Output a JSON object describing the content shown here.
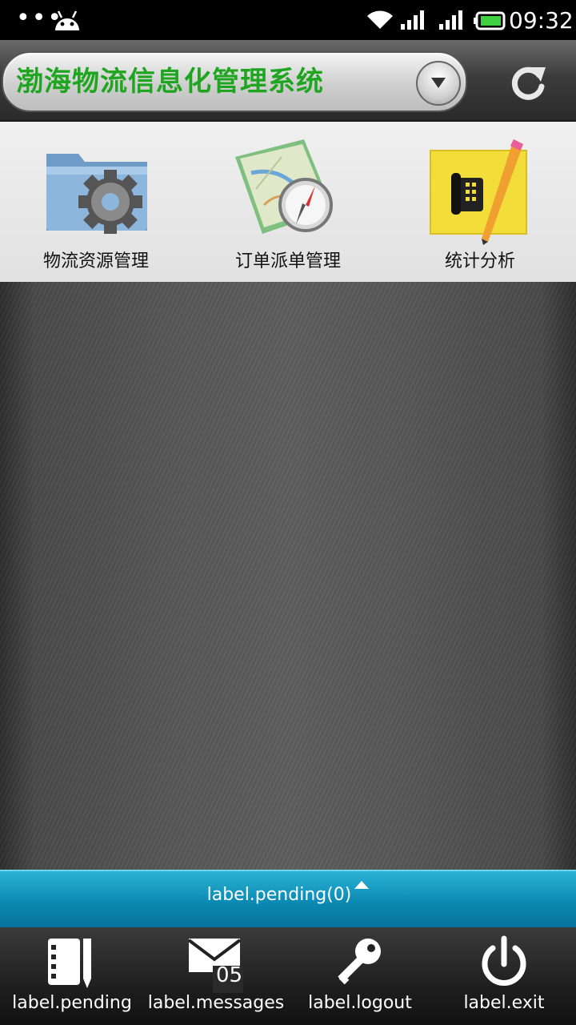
{
  "status_bar": {
    "time": "09:32",
    "icons": [
      "more-dots-icon",
      "android-icon",
      "wifi-icon",
      "signal-icon",
      "signal-icon",
      "battery-icon"
    ]
  },
  "header": {
    "title": "渤海物流信息化管理系统",
    "title_color": "#1fa51f"
  },
  "modules": [
    {
      "label": "物流资源管理",
      "icon": "folder-gear-icon"
    },
    {
      "label": "订单派单管理",
      "icon": "map-compass-icon"
    },
    {
      "label": "统计分析",
      "icon": "phone-note-icon"
    }
  ],
  "pending_bar": {
    "text": "label.pending(0)",
    "color": "#0b8ab3"
  },
  "bottom_nav": {
    "items": [
      {
        "label": "label.pending",
        "icon": "pending-list-icon"
      },
      {
        "label": "label.messages",
        "icon": "mail-icon",
        "badge": "05"
      },
      {
        "label": "label.logout",
        "icon": "key-icon"
      },
      {
        "label": "label.exit",
        "icon": "power-icon"
      }
    ]
  }
}
